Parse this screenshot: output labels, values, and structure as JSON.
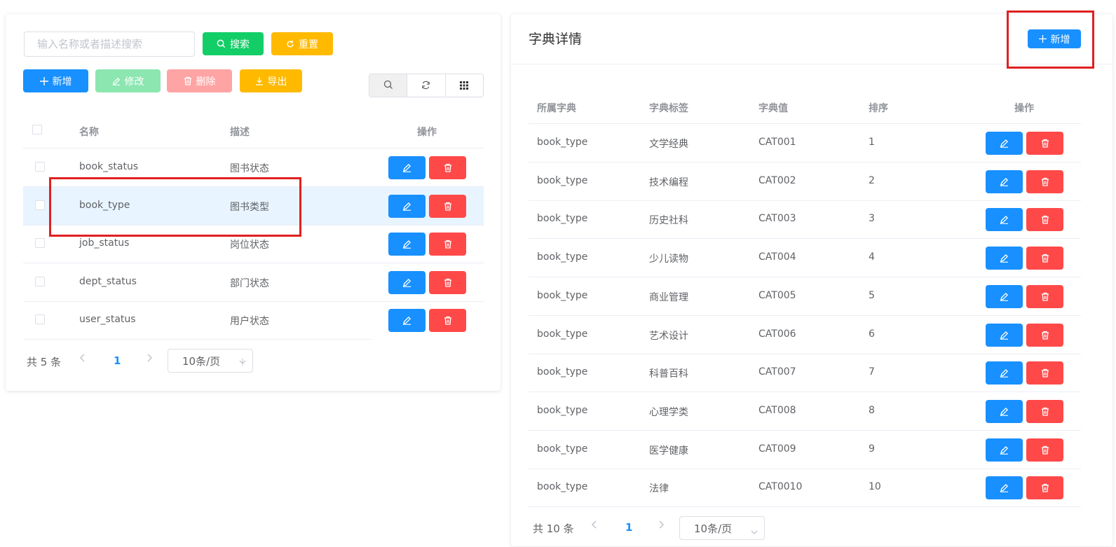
{
  "left": {
    "search": {
      "placeholder": "输入名称或者描述搜索",
      "value": ""
    },
    "search_button": "搜索",
    "reset_button": "重置",
    "toolbar": {
      "add": "新增",
      "edit": "修改",
      "delete": "删除",
      "export": "导出"
    },
    "table": {
      "columns": [
        "名称",
        "描述",
        "操作"
      ],
      "rows": [
        {
          "name": "book_status",
          "desc": "图书状态"
        },
        {
          "name": "book_type",
          "desc": "图书类型"
        },
        {
          "name": "job_status",
          "desc": "岗位状态"
        },
        {
          "name": "dept_status",
          "desc": "部门状态"
        },
        {
          "name": "user_status",
          "desc": "用户状态"
        }
      ]
    },
    "pager": {
      "total": "共 5 条",
      "page": "1",
      "size": "10条/页"
    }
  },
  "right": {
    "title": "字典详情",
    "add_button": "新增",
    "table": {
      "columns": [
        "所属字典",
        "字典标签",
        "字典值",
        "排序",
        "操作"
      ],
      "rows": [
        {
          "dict": "book_type",
          "label": "文学经典",
          "value": "CAT001",
          "sort": "1"
        },
        {
          "dict": "book_type",
          "label": "技术编程",
          "value": "CAT002",
          "sort": "2"
        },
        {
          "dict": "book_type",
          "label": "历史社科",
          "value": "CAT003",
          "sort": "3"
        },
        {
          "dict": "book_type",
          "label": "少儿读物",
          "value": "CAT004",
          "sort": "4"
        },
        {
          "dict": "book_type",
          "label": "商业管理",
          "value": "CAT005",
          "sort": "5"
        },
        {
          "dict": "book_type",
          "label": "艺术设计",
          "value": "CAT006",
          "sort": "6"
        },
        {
          "dict": "book_type",
          "label": "科普百科",
          "value": "CAT007",
          "sort": "7"
        },
        {
          "dict": "book_type",
          "label": "心理学类",
          "value": "CAT008",
          "sort": "8"
        },
        {
          "dict": "book_type",
          "label": "医学健康",
          "value": "CAT009",
          "sort": "9"
        },
        {
          "dict": "book_type",
          "label": "法律",
          "value": "CAT0010",
          "sort": "10"
        }
      ]
    },
    "pager": {
      "total": "共 10 条",
      "page": "1",
      "size": "10条/页"
    }
  },
  "colors": {
    "primary": "#1890ff",
    "success": "#13ce66",
    "warning": "#ffba00",
    "danger": "#ff4949",
    "annotation": "#e02020"
  }
}
